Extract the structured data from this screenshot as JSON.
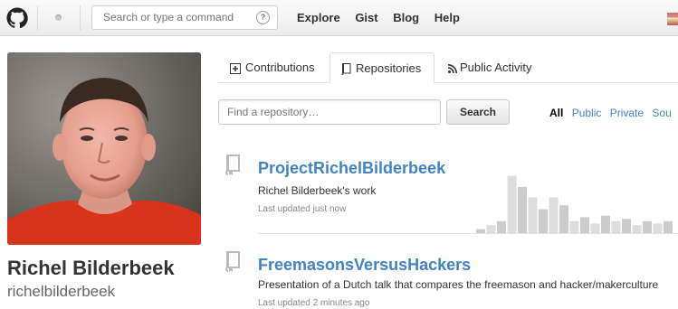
{
  "header": {
    "search_placeholder": "Search or type a command",
    "help_glyph": "?",
    "nav": [
      "Explore",
      "Gist",
      "Blog",
      "Help"
    ],
    "logo_icon": "octocat-icon",
    "notification_icon": "notification-dot-icon"
  },
  "profile": {
    "name": "Richel Bilderbeek",
    "username": "richelbilderbeek"
  },
  "tabs": [
    {
      "label": "Contributions",
      "icon": "contributions-icon",
      "active": false
    },
    {
      "label": "Repositories",
      "icon": "repo-book-icon",
      "active": true
    },
    {
      "label": "Public Activity",
      "icon": "rss-icon",
      "active": false
    }
  ],
  "repo_filter": {
    "placeholder": "Find a repository…",
    "search_label": "Search",
    "filters": [
      "All",
      "Public",
      "Private",
      "Sou"
    ],
    "selected": "All"
  },
  "repositories": [
    {
      "name": "ProjectRichelBilderbeek",
      "description": "Richel Bilderbeek's work",
      "updated": "Last updated just now",
      "activity": [
        0.05,
        0.1,
        0.15,
        0.72,
        0.58,
        0.45,
        0.3,
        0.45,
        0.35,
        0.15,
        0.2,
        0.12,
        0.22,
        0.15,
        0.18,
        0.1,
        0.15,
        0.12,
        0.15
      ]
    },
    {
      "name": "FreemasonsVersusHackers",
      "description": "Presentation of a Dutch talk that compares the freemason and hacker/makerculture",
      "updated": "Last updated 2 minutes ago"
    }
  ],
  "colors": {
    "link": "#4183c4",
    "graph_bar": "#dddddd",
    "graph_bar_dark": "#cccccc"
  }
}
